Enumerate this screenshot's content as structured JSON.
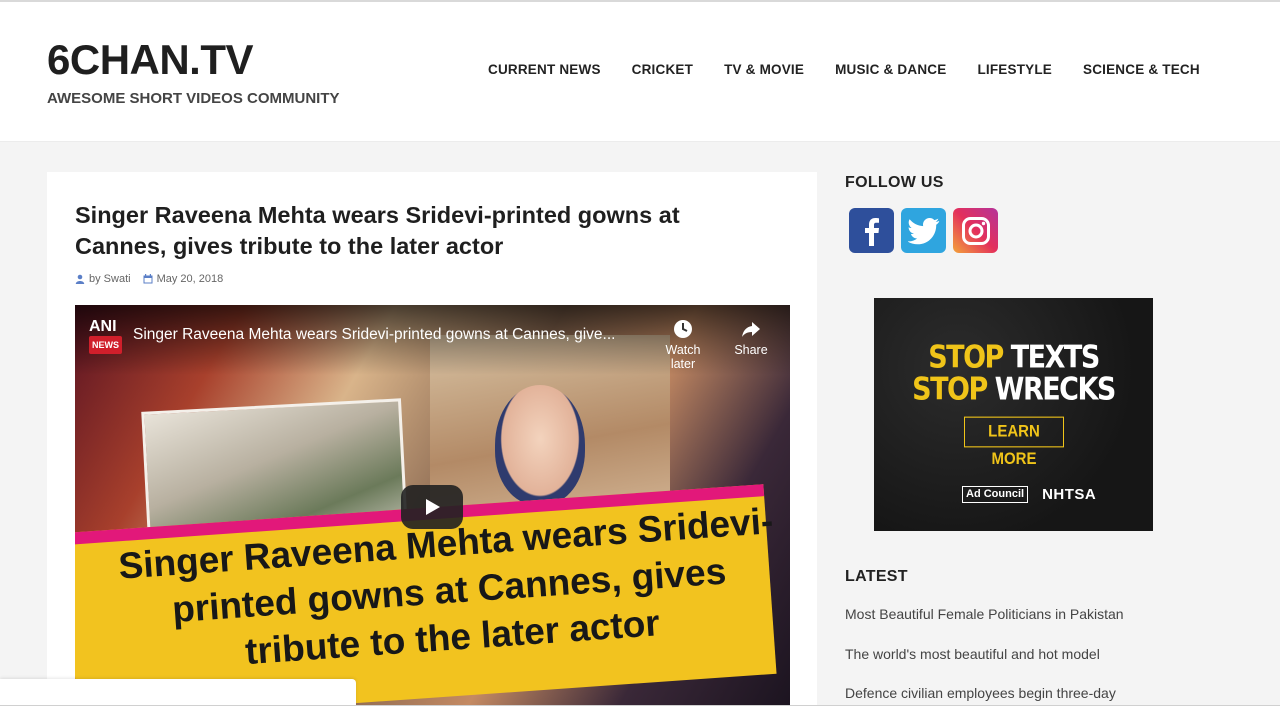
{
  "header": {
    "logo": "6CHAN.TV",
    "tagline": "AWESOME SHORT VIDEOS COMMUNITY",
    "nav": [
      "CURRENT NEWS",
      "CRICKET",
      "TV & MOVIE",
      "MUSIC & DANCE",
      "LIFESTYLE",
      "SCIENCE & TECH"
    ]
  },
  "article": {
    "title": "Singer Raveena Mehta wears Sridevi-printed gowns at Cannes, gives tribute to the later actor",
    "author": "by Swati",
    "date": "May 20, 2018"
  },
  "video": {
    "channel": "ANI",
    "channel_badge": "NEWS",
    "title": "Singer Raveena Mehta wears Sridevi-printed gowns at Cannes, give...",
    "watch_later": "Watch later",
    "share": "Share",
    "headline": "Singer Raveena Mehta wears Sridevi-printed gowns at Cannes, gives tribute to the later actor"
  },
  "sidebar": {
    "follow_heading": "FOLLOW US",
    "social": [
      {
        "name": "facebook-icon",
        "color": "#2e4f9b"
      },
      {
        "name": "twitter-icon",
        "color": "#2fa5df"
      },
      {
        "name": "instagram-icon",
        "color": "#e3305b"
      }
    ],
    "ad": {
      "line1_a": "STOP",
      "line1_b": "TEXTS",
      "line2_a": "STOP",
      "line2_b": "WRECKS",
      "button": "LEARN MORE",
      "logo1": "Ad Council",
      "logo2": "NHTSA"
    },
    "latest_heading": "LATEST",
    "latest": [
      "Most Beautiful Female Politicians in Pakistan",
      "The world's most beautiful and hot model",
      "Defence civilian employees begin three-day"
    ]
  },
  "colors": {
    "accent": "#f0c419",
    "background": "#f4f4f4"
  }
}
